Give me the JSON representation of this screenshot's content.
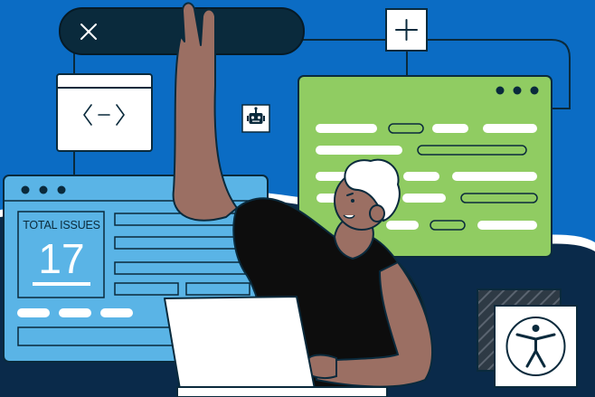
{
  "card": {
    "label": "TOTAL ISSUES",
    "count": "17"
  },
  "icons": {
    "close": "close-icon",
    "add": "plus-icon",
    "code": "code-icon",
    "robot": "robot-icon",
    "accessibility": "accessibility-icon"
  },
  "colors": {
    "background": "#0b6cc4",
    "panel_dark": "#0a2a3c",
    "blue_window": "#5ab4e6",
    "green_window": "#90cc62",
    "skin": "#9b6f63",
    "shirt": "#0d0d0d"
  }
}
